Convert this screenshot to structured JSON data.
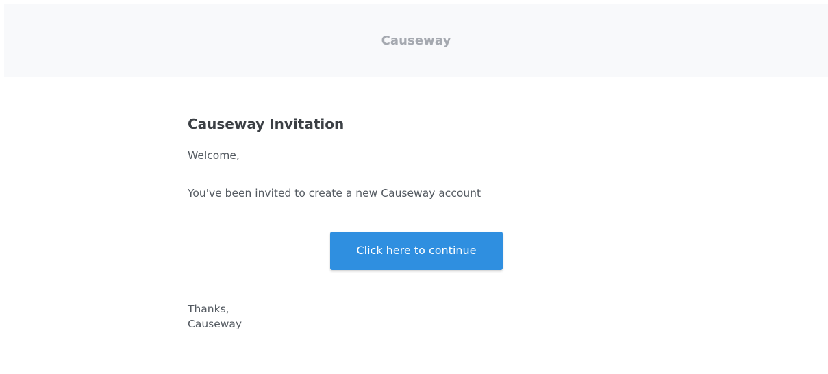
{
  "header": {
    "brand": "Causeway"
  },
  "email": {
    "heading": "Causeway Invitation",
    "greeting": "Welcome,",
    "message": "You've been invited to create a new Causeway account",
    "button_label": "Click here to continue",
    "signoff_line1": "Thanks,",
    "signoff_line2": "Causeway"
  },
  "colors": {
    "header_bg": "#f8f9fb",
    "brand_text": "#a5a9b0",
    "button_bg": "#2f8fe0",
    "body_text": "#545a61",
    "heading_text": "#3c4045"
  }
}
